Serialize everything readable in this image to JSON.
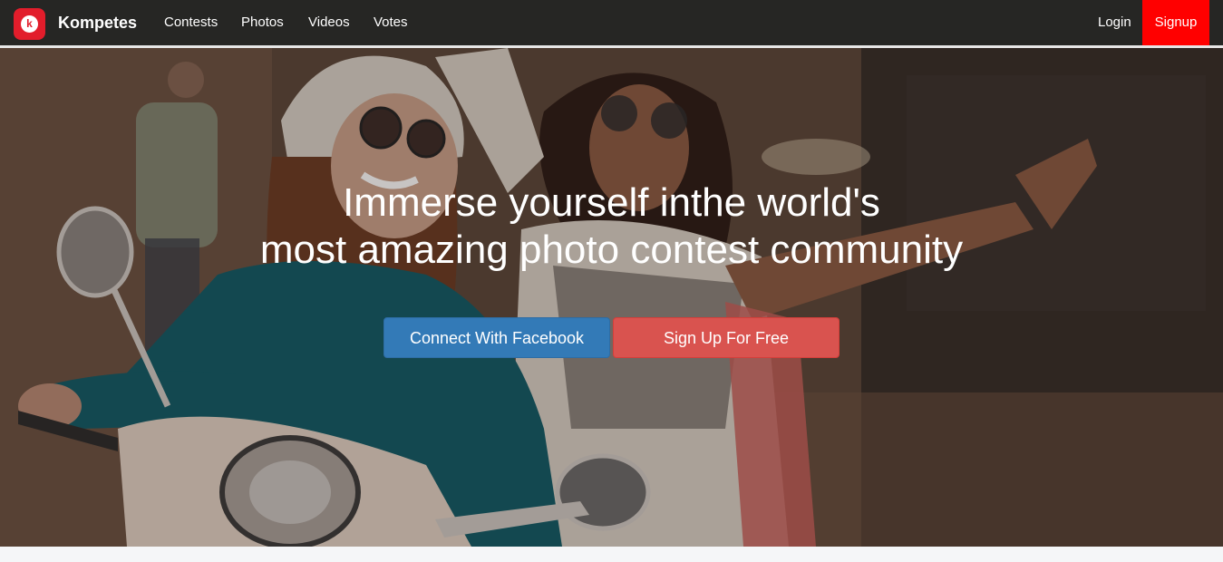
{
  "navbar": {
    "brand": "Kompetes",
    "logo_letter": "k",
    "links": [
      "Contests",
      "Photos",
      "Videos",
      "Votes"
    ],
    "login": "Login",
    "signup": "Signup"
  },
  "hero": {
    "headline_line1": "Immerse yourself inthe world's",
    "headline_line2": "most amazing photo contest community",
    "facebook_button": "Connect With Facebook",
    "signup_button": "Sign Up For Free"
  },
  "colors": {
    "navbar_bg": "#262624",
    "signup_red": "#ff0000",
    "facebook_blue": "#337ab7",
    "signup_button_red": "#d9534f"
  }
}
